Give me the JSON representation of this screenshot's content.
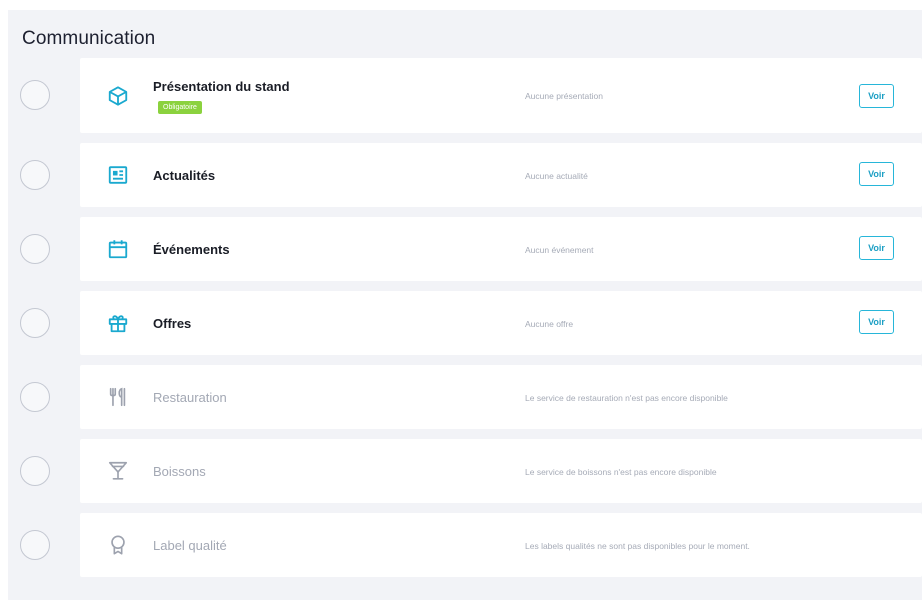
{
  "section": {
    "title": "Communication"
  },
  "colors": {
    "accent": "#27b6d9",
    "badge": "#8bd23e",
    "disabled": "#a3a8b4"
  },
  "items": [
    {
      "title": "Présentation du stand",
      "badge": "Obligatoire",
      "description": "Aucune présentation",
      "button": "Voir",
      "icon": "box-icon",
      "enabled": true
    },
    {
      "title": "Actualités",
      "description": "Aucune actualité",
      "button": "Voir",
      "icon": "news-icon",
      "enabled": true
    },
    {
      "title": "Événements",
      "description": "Aucun événement",
      "button": "Voir",
      "icon": "calendar-icon",
      "enabled": true
    },
    {
      "title": "Offres",
      "description": "Aucune offre",
      "button": "Voir",
      "icon": "gift-icon",
      "enabled": true
    },
    {
      "title": "Restauration",
      "description": "Le service de restauration n'est pas encore disponible",
      "icon": "fork-knife-icon",
      "enabled": false
    },
    {
      "title": "Boissons",
      "description": "Le service de boissons n'est pas encore disponible",
      "icon": "cocktail-icon",
      "enabled": false
    },
    {
      "title": "Label qualité",
      "description": "Les labels qualités ne sont pas disponibles pour le moment.",
      "icon": "award-icon",
      "enabled": false
    }
  ]
}
